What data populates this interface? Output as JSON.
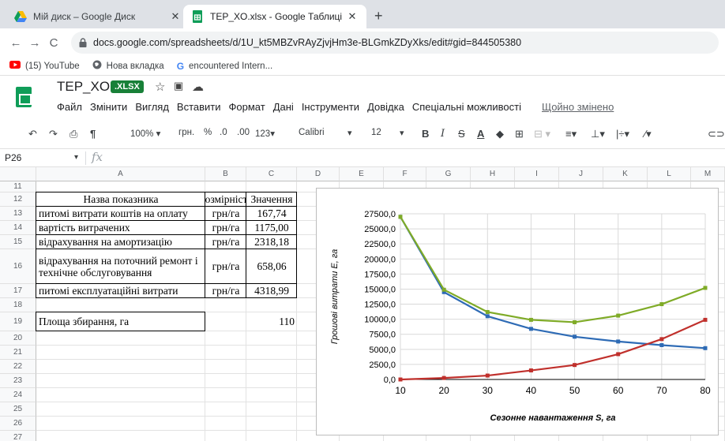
{
  "browser": {
    "tabs": [
      {
        "title": "Мій диск – Google Диск",
        "active": false
      },
      {
        "title": "TEP_XO.xlsx - Google Таблиці",
        "active": true
      }
    ],
    "url": "docs.google.com/spreadsheets/d/1U_kt5MBZvRAyZjvjHm3e-BLGmkZDyXks/edit#gid=844505380",
    "bookmarks": [
      "(15) YouTube",
      "Нова вкладка",
      "encountered Intern..."
    ]
  },
  "sheets": {
    "title": "TEP_XO",
    "badge": ".XLSX",
    "menu": [
      "Файл",
      "Змінити",
      "Вигляд",
      "Вставити",
      "Формат",
      "Дані",
      "Інструменти",
      "Довідка",
      "Спеціальні можливості"
    ],
    "saved_status": "Щойно змінено",
    "toolbar": {
      "zoom": "100%",
      "currency": "грн.",
      "percent": "%",
      "dec_less": ".0",
      "dec_more": ".00",
      "number_format": "123",
      "font": "Calibri",
      "font_size": "12"
    },
    "name_box": "P26",
    "fx": "fx",
    "columns": [
      "A",
      "B",
      "C",
      "D",
      "E",
      "F",
      "G",
      "H",
      "I",
      "J",
      "K",
      "L",
      "M"
    ],
    "rows": [
      "11",
      "12",
      "13",
      "14",
      "15",
      "16",
      "17",
      "18",
      "19",
      "20",
      "21",
      "22",
      "23",
      "24",
      "25",
      "26",
      "27"
    ],
    "table": {
      "header": [
        "Назва показника",
        "Розмірність",
        "Значення"
      ],
      "rows": [
        {
          "name": "питомі витрати коштів на оплату",
          "unit": "грн/га",
          "value": "167,74"
        },
        {
          "name": "вартість витрачених",
          "unit": "грн/га",
          "value": "1175,00"
        },
        {
          "name": "відрахування на амортизацію",
          "unit": "грн/га",
          "value": "2318,18"
        },
        {
          "name": "відрахування на поточний ремонт і технічне обслуговування",
          "unit": "грн/га",
          "value": "658,06"
        },
        {
          "name": "питомі експлуатаційні витрати",
          "unit": "грн/га",
          "value": "4318,99"
        }
      ],
      "area_label": "Площа збирання, га",
      "area_value": "110"
    }
  },
  "chart_data": {
    "type": "line",
    "title": "",
    "xlabel": "Сезонне навантаження S, га",
    "ylabel": "Грошові витрати Е, га",
    "x": [
      10,
      20,
      30,
      40,
      50,
      60,
      70,
      80
    ],
    "xlim": [
      10,
      80
    ],
    "ylim": [
      0,
      27500
    ],
    "yticks": [
      "0,0",
      "2500,0",
      "5000,0",
      "7500,0",
      "10000,0",
      "12500,0",
      "15000,0",
      "17500,0",
      "20000,0",
      "22500,0",
      "25000,0",
      "27500,0"
    ],
    "xticks": [
      "10",
      "20",
      "30",
      "40",
      "50",
      "60",
      "70",
      "80"
    ],
    "grid": true,
    "legend": "none",
    "series": [
      {
        "color": "#2e6bb5",
        "values": [
          27000,
          14500,
          10500,
          8400,
          7100,
          6300,
          5700,
          5200
        ]
      },
      {
        "color": "#c0302c",
        "values": [
          0,
          250,
          650,
          1500,
          2400,
          4200,
          6700,
          9900
        ]
      },
      {
        "color": "#7fab27",
        "values": [
          27000,
          14900,
          11200,
          9900,
          9500,
          10600,
          12500,
          15200
        ]
      }
    ]
  },
  "colors": {
    "sheets_green": "#0f9d58",
    "xlsx_badge": "#188038",
    "tab_bar": "#dee1e6"
  }
}
